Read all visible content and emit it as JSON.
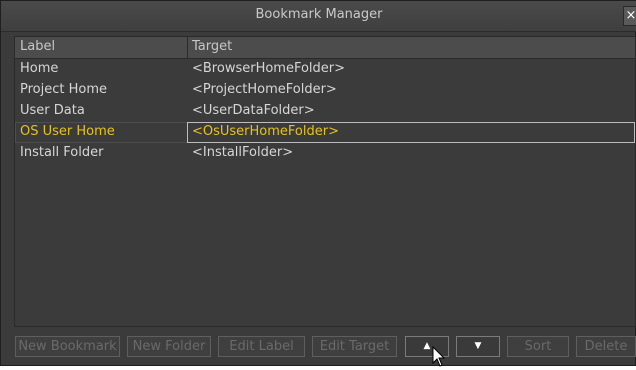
{
  "window": {
    "title": "Bookmark Manager",
    "close_label": "×"
  },
  "table": {
    "headers": [
      "Label",
      "Target"
    ],
    "rows": [
      {
        "label": "Home",
        "target": "<BrowserHomeFolder>"
      },
      {
        "label": "Project Home",
        "target": "<ProjectHomeFolder>"
      },
      {
        "label": "User Data",
        "target": "<UserDataFolder>"
      },
      {
        "label": "OS User Home",
        "target": "<OsUserHomeFolder>"
      },
      {
        "label": "Install Folder",
        "target": "<InstallFolder>"
      }
    ],
    "selected_row": 3
  },
  "buttons": {
    "new_bookmark": "New Bookmark",
    "new_folder": "New Folder",
    "edit_label": "Edit Label",
    "edit_target": "Edit Target",
    "move_up": "▲",
    "move_down": "▼",
    "sort": "Sort",
    "delete": "Delete"
  },
  "colors": {
    "selection_text": "#e6c21c",
    "background": "#3b3b3b"
  }
}
